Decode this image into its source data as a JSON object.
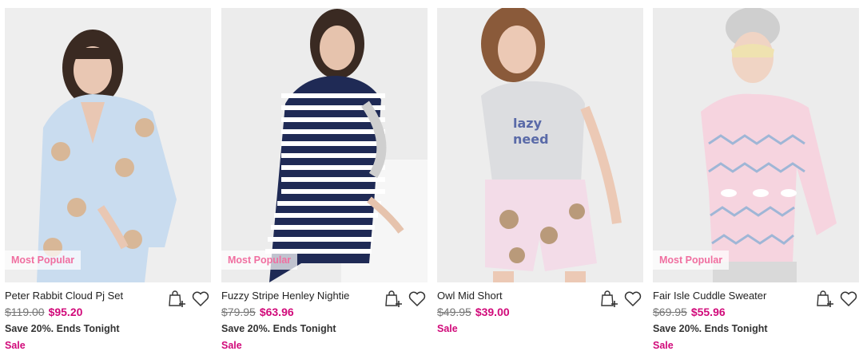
{
  "colors": {
    "sale_price": "#d10a7a",
    "badge_text": "#f06fa0",
    "was_price": "#777777"
  },
  "icons": {
    "add_to_bag": "shopping-bag-plus-icon",
    "wishlist": "heart-outline-icon"
  },
  "products": [
    {
      "name": "Peter Rabbit Cloud Pj Set",
      "was_price": "$119.00",
      "price": "$95.20",
      "promo": "Save 20%. Ends Tonight",
      "sale": "Sale",
      "badge": "Most Popular"
    },
    {
      "name": "Fuzzy Stripe Henley Nightie",
      "was_price": "$79.95",
      "price": "$63.96",
      "promo": "Save 20%. Ends Tonight",
      "sale": "Sale",
      "badge": "Most Popular"
    },
    {
      "name": "Owl Mid Short",
      "was_price": "$49.95",
      "price": "$39.00",
      "sale": "Sale"
    },
    {
      "name": "Fair Isle Cuddle Sweater",
      "was_price": "$69.95",
      "price": "$55.96",
      "promo": "Save 20%. Ends Tonight",
      "sale": "Sale",
      "badge": "Most Popular"
    }
  ]
}
